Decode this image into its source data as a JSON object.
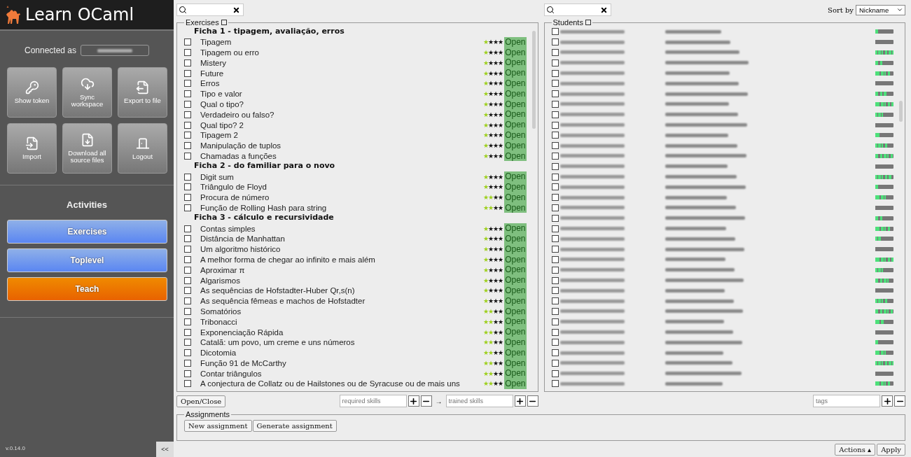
{
  "app": {
    "title": "Learn OCaml",
    "connected_label": "Connected as",
    "version": "v.0.14.0",
    "collapse": "<<"
  },
  "sidebar_buttons": [
    {
      "label": "Show token"
    },
    {
      "label": "Sync workspace"
    },
    {
      "label": "Export to file"
    },
    {
      "label": "Import"
    },
    {
      "label": "Download all source files"
    },
    {
      "label": "Logout"
    }
  ],
  "activities": {
    "title": "Activities",
    "items": [
      {
        "label": "Exercises",
        "selected": false
      },
      {
        "label": "Toplevel",
        "selected": false
      },
      {
        "label": "Teach",
        "selected": true
      }
    ]
  },
  "exercises": {
    "legend": "Exercises",
    "legend_checked": false,
    "groups": [
      {
        "title": "Ficha 1 - tipagem, avaliação, erros",
        "items": [
          {
            "title": "Tipagem",
            "checked": false,
            "stars": 1,
            "status": "Open"
          },
          {
            "title": "Tipagem ou erro",
            "checked": false,
            "stars": 1,
            "status": "Open"
          },
          {
            "title": "Mistery",
            "checked": false,
            "stars": 1,
            "status": "Open"
          },
          {
            "title": "Future",
            "checked": false,
            "stars": 1,
            "status": "Open"
          },
          {
            "title": "Erros",
            "checked": false,
            "stars": 1,
            "status": "Open"
          },
          {
            "title": "Tipo e valor",
            "checked": false,
            "stars": 1,
            "status": "Open"
          },
          {
            "title": "Qual o tipo?",
            "checked": false,
            "stars": 1,
            "status": "Open"
          },
          {
            "title": "Verdadeiro ou falso?",
            "checked": false,
            "stars": 1,
            "status": "Open"
          },
          {
            "title": "Qual tipo? 2",
            "checked": false,
            "stars": 1,
            "status": "Open"
          },
          {
            "title": "Tipagem 2",
            "checked": false,
            "stars": 1,
            "status": "Open"
          },
          {
            "title": "Manipulação de tuplos",
            "checked": false,
            "stars": 1,
            "status": "Open"
          },
          {
            "title": "Chamadas a funções",
            "checked": false,
            "stars": 1,
            "status": "Open"
          }
        ]
      },
      {
        "title": "Ficha 2 - do familiar para o novo",
        "items": [
          {
            "title": "Digit sum",
            "checked": false,
            "stars": 1,
            "status": "Open"
          },
          {
            "title": "Triângulo de Floyd",
            "checked": false,
            "stars": 1,
            "status": "Open"
          },
          {
            "title": "Procura de número",
            "checked": false,
            "stars": 2,
            "status": "Open"
          },
          {
            "title": "Função de Rolling Hash para string",
            "checked": false,
            "stars": 2,
            "status": "Open"
          }
        ]
      },
      {
        "title": "Ficha 3 - cálculo e recursividade",
        "items": [
          {
            "title": "Contas simples",
            "checked": false,
            "stars": 1,
            "status": "Open"
          },
          {
            "title": "Distância de Manhattan",
            "checked": false,
            "stars": 1,
            "status": "Open"
          },
          {
            "title": "Um algoritmo histórico",
            "checked": false,
            "stars": 1,
            "status": "Open"
          },
          {
            "title": "A melhor forma de chegar ao infinito e mais além",
            "checked": false,
            "stars": 1,
            "status": "Open"
          },
          {
            "title": "Aproximar π",
            "checked": false,
            "stars": 1,
            "status": "Open"
          },
          {
            "title": "Algarismos",
            "checked": false,
            "stars": 1,
            "status": "Open"
          },
          {
            "title": "As sequências de Hofstadter-Huber Qr,s(n)",
            "checked": false,
            "stars": 1,
            "status": "Open"
          },
          {
            "title": "As sequência fêmeas e machos de Hofstadter",
            "checked": false,
            "stars": 1,
            "status": "Open"
          },
          {
            "title": "Somatórios",
            "checked": false,
            "stars": 2,
            "status": "Open"
          },
          {
            "title": "Tribonacci",
            "checked": false,
            "stars": 2,
            "status": "Open"
          },
          {
            "title": "Exponenciação Rápida",
            "checked": false,
            "stars": 2,
            "status": "Open"
          },
          {
            "title": "Catalã: um povo, um creme e uns números",
            "checked": false,
            "stars": 2,
            "status": "Open"
          },
          {
            "title": "Dicotomia",
            "checked": false,
            "stars": 2,
            "status": "Open"
          },
          {
            "title": "Função 91 de McCarthy",
            "checked": false,
            "stars": 2,
            "status": "Open"
          },
          {
            "title": "Contar triângulos",
            "checked": false,
            "stars": 2,
            "status": "Open"
          },
          {
            "title": "A conjectura de Collatz ou de Hailstones ou de Syracuse ou de mais uns",
            "checked": false,
            "stars": 2,
            "status": "Open"
          }
        ]
      }
    ]
  },
  "exercise_tools": {
    "open_close": "Open/Close",
    "required_placeholder": "required skills",
    "trained_placeholder": "trained skills",
    "arrow": "→"
  },
  "students": {
    "legend": "Students",
    "legend_checked": false,
    "sort_label": "Sort by",
    "sort_value": "Nickname",
    "tags_placeholder": "tags",
    "rows": [
      {
        "checked": false
      },
      {
        "checked": false
      },
      {
        "checked": false
      },
      {
        "checked": false
      },
      {
        "checked": false
      },
      {
        "checked": false
      },
      {
        "checked": false
      },
      {
        "checked": false
      },
      {
        "checked": false
      },
      {
        "checked": false
      },
      {
        "checked": false
      },
      {
        "checked": false
      },
      {
        "checked": false
      },
      {
        "checked": false
      },
      {
        "checked": false
      },
      {
        "checked": false
      },
      {
        "checked": false
      },
      {
        "checked": false
      },
      {
        "checked": false
      },
      {
        "checked": false
      },
      {
        "checked": false
      },
      {
        "checked": false
      },
      {
        "checked": false
      },
      {
        "checked": false
      },
      {
        "checked": false
      },
      {
        "checked": false
      },
      {
        "checked": false
      },
      {
        "checked": false
      },
      {
        "checked": false
      },
      {
        "checked": false
      },
      {
        "checked": false
      },
      {
        "checked": false
      },
      {
        "checked": false
      },
      {
        "checked": false
      },
      {
        "checked": false
      }
    ]
  },
  "assignments": {
    "legend": "Assignments",
    "buttons": [
      "New assignment",
      "Generate assignment"
    ]
  },
  "footer": {
    "actions": "Actions ▴",
    "apply": "Apply"
  }
}
